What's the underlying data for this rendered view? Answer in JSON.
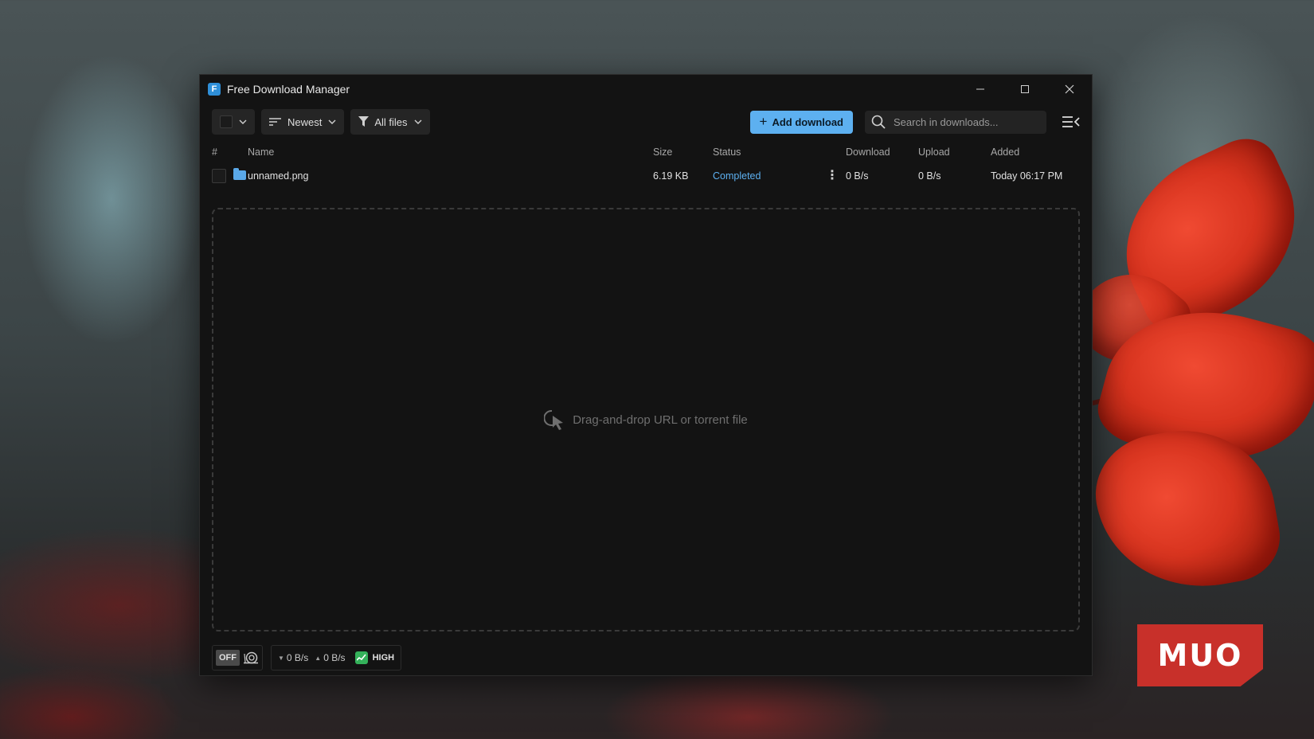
{
  "window": {
    "title": "Free Download Manager"
  },
  "toolbar": {
    "sort_label": "Newest",
    "filter_label": "All files",
    "add_download_label": "Add download",
    "search_placeholder": "Search in downloads..."
  },
  "table": {
    "columns": [
      "#",
      "Name",
      "Size",
      "Status",
      "Download",
      "Upload",
      "Added"
    ],
    "rows": [
      {
        "name": "unnamed.png",
        "size": "6.19 KB",
        "status": "Completed",
        "download": "0 B/s",
        "upload": "0 B/s",
        "added": "Today 06:17 PM"
      }
    ]
  },
  "dropzone": {
    "text": "Drag-and-drop URL or torrent file"
  },
  "statusbar": {
    "snail_mode": "OFF",
    "down_speed": "0 B/s",
    "up_speed": "0 B/s",
    "traffic_mode": "HIGH"
  },
  "watermark": {
    "text": "MUO"
  },
  "colors": {
    "accent": "#5db0f0",
    "window_bg": "#131313",
    "high_mode": "#34b15a"
  }
}
